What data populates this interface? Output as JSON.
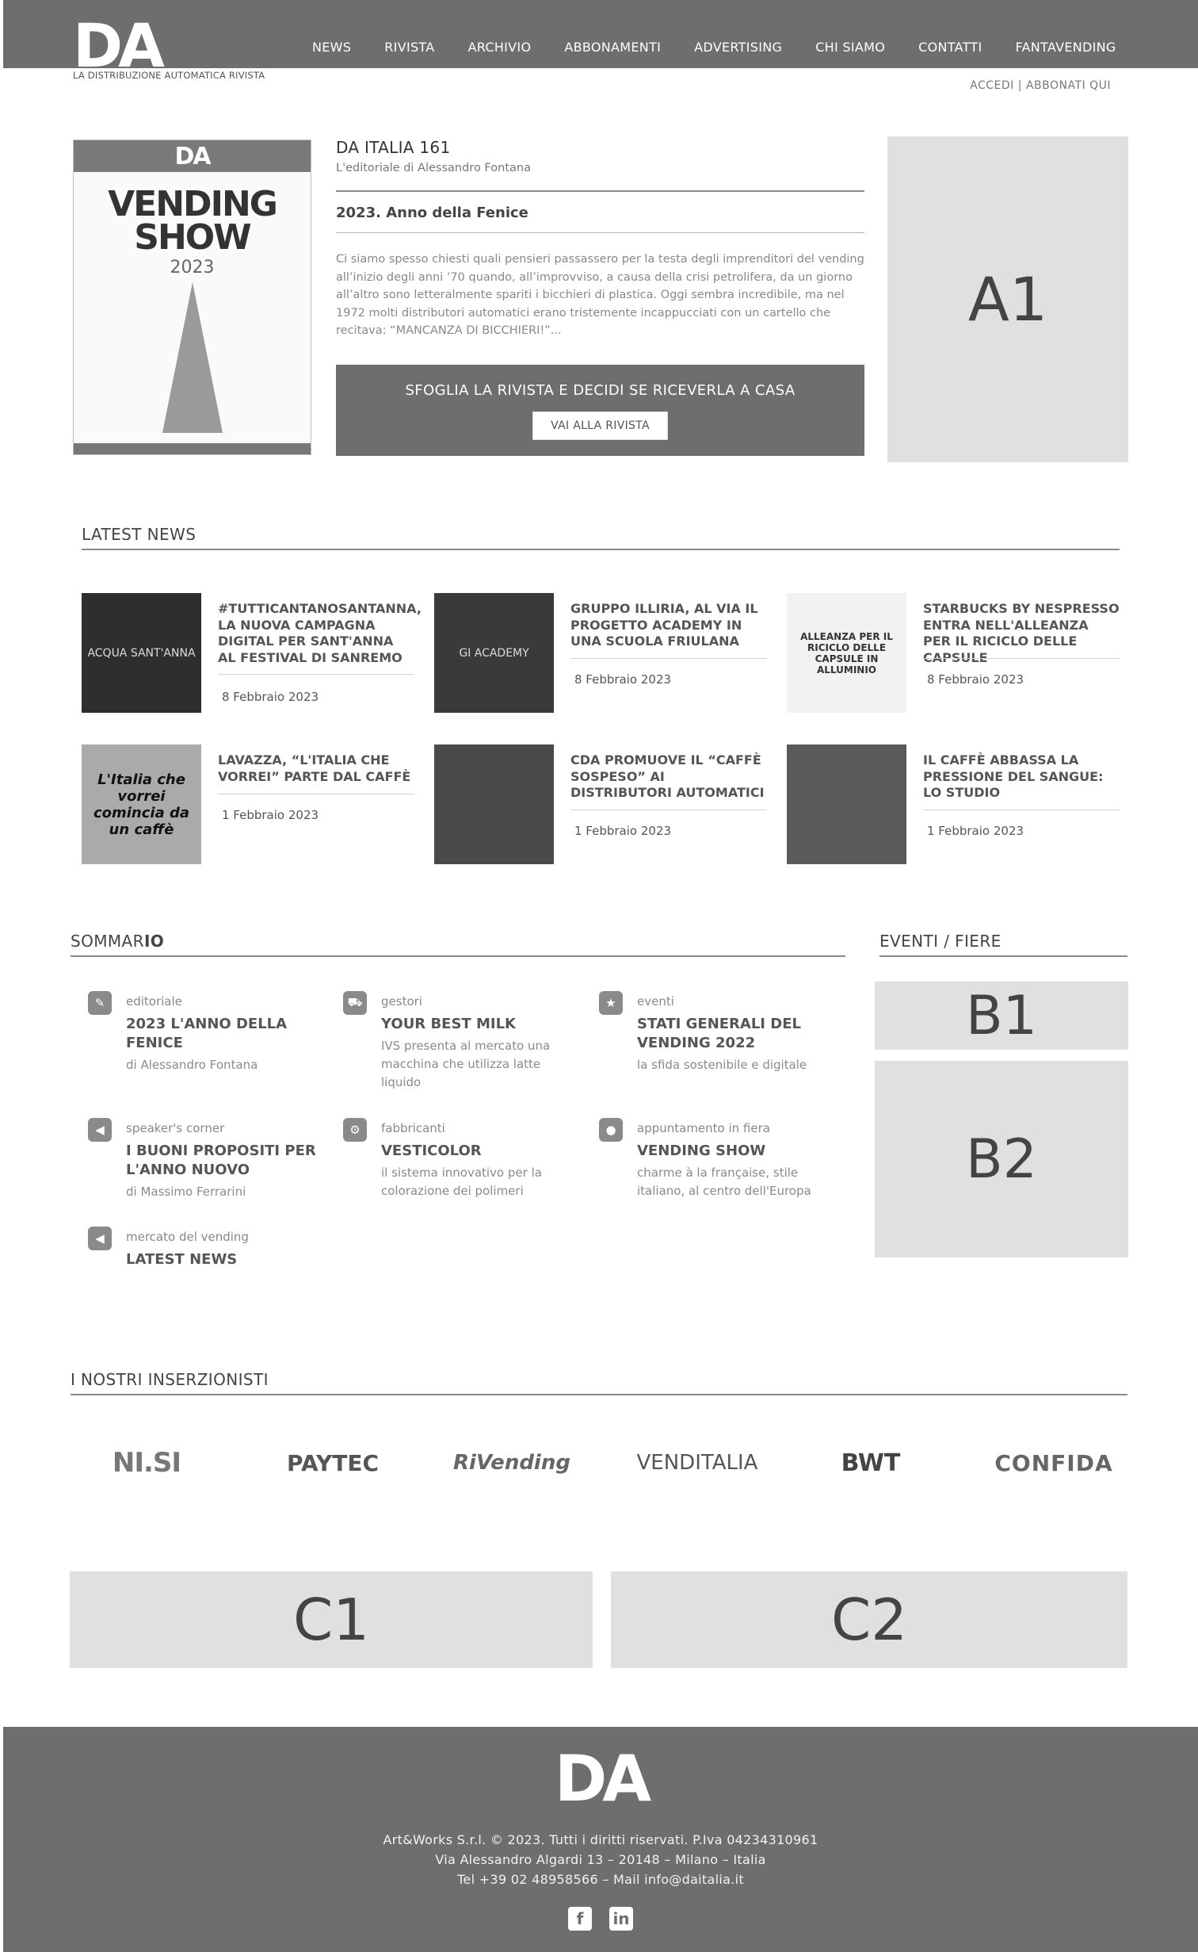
{
  "brand": {
    "logo_text": "DA",
    "tagline": "LA DISTRIBUZIONE AUTOMATICA RIVISTA"
  },
  "nav": {
    "items": [
      "NEWS",
      "RIVISTA",
      "ARCHIVIO",
      "ABBONAMENTI",
      "ADVERTISING",
      "CHI SIAMO",
      "CONTATTI",
      "FANTAVENDING"
    ]
  },
  "account": {
    "login": "ACCEDI",
    "separator": "|",
    "subscribe": "ABBONATI QUI"
  },
  "hero": {
    "cover": {
      "top": "DA",
      "title_line1": "VENDING",
      "title_line2": "SHOW",
      "year": "2023"
    },
    "label": "DA ITALIA 161",
    "author": "L'editoriale di Alessandro Fontana",
    "headline": "2023. Anno della Fenice",
    "body": "Ci siamo spesso chiesti quali pensieri passassero per la testa degli imprenditori del vending all’inizio degli anni ’70 quando, all’improvviso, a causa della crisi petrolifera, da un giorno all’altro sono letteralmente spariti i bicchieri di plastica. Oggi sembra incredibile, ma nel 1972 molti distributori automatici erano tristemente incappucciati con un cartello che recitava: “MANCANZA DI BICCHIERI!”...",
    "cta_text": "SFOGLIA LA RIVISTA E DECIDI SE RICEVERLA A CASA",
    "cta_button": "VAI ALLA RIVISTA"
  },
  "ads": {
    "a1": "A1",
    "b1": "B1",
    "b2": "B2",
    "c1": "C1",
    "c2": "C2"
  },
  "latest_news": {
    "title": "LATEST NEWS",
    "items": [
      {
        "title": "#TUTTICANTANOSANTANNA, LA NUOVA CAMPAGNA DIGITAL PER SANT'ANNA AL FESTIVAL DI SANREMO",
        "date": "8 Febbraio 2023",
        "thumb": "ACQUA SANT'ANNA"
      },
      {
        "title": "GRUPPO ILLIRIA, AL VIA IL PROGETTO ACADEMY IN UNA SCUOLA FRIULANA",
        "date": "8 Febbraio 2023",
        "thumb": "GI ACADEMY"
      },
      {
        "title": "STARBUCKS BY NESPRESSO ENTRA NELL'ALLEANZA PER IL RICICLO DELLE CAPSULE",
        "date": "8 Febbraio 2023",
        "thumb": "ALLEANZA PER IL RICICLO DELLE CAPSULE IN ALLUMINIO"
      },
      {
        "title": "LAVAZZA, “L'ITALIA CHE VORREI” PARTE DAL CAFFÈ",
        "date": "1 Febbraio 2023",
        "thumb": "L'Italia che vorrei comincia da un caffè"
      },
      {
        "title": "CDA PROMUOVE IL “CAFFÈ SOSPESO” AI DISTRIBUTORI AUTOMATICI",
        "date": "1 Febbraio 2023",
        "thumb": ""
      },
      {
        "title": "IL CAFFÈ ABBASSA LA PRESSIONE DEL SANGUE: LO STUDIO",
        "date": "1 Febbraio 2023",
        "thumb": ""
      }
    ]
  },
  "sommario": {
    "title_a": "SOMMAR",
    "title_b": "IO",
    "items": [
      {
        "category": "editoriale",
        "title": "2023 L'ANNO DELLA FENICE",
        "desc": "di Alessandro Fontana"
      },
      {
        "category": "gestori",
        "title": "YOUR BEST MILK",
        "desc": "IVS presenta al mercato una macchina che utilizza latte liquido"
      },
      {
        "category": "eventi",
        "title": "STATI GENERALI DEL VENDING 2022",
        "desc": "la sfida sostenibile e digitale"
      },
      {
        "category": "speaker's corner",
        "title": "I BUONI PROPOSITI PER L'ANNO NUOVO",
        "desc": "di Massimo Ferrarini"
      },
      {
        "category": "fabbricanti",
        "title": "VESTICOLOR",
        "desc": "il sistema innovativo per la colorazione dei polimeri"
      },
      {
        "category": "appuntamento in fiera",
        "title": "VENDING SHOW",
        "desc": "charme à la française, stile italiano, al centro dell'Europa"
      },
      {
        "category": "mercato del vending",
        "title": "LATEST NEWS",
        "desc": ""
      }
    ]
  },
  "eventi": {
    "title": "EVENTI / FIERE"
  },
  "inserzionisti": {
    "title": "I NOSTRI INSERZIONISTI",
    "logos": [
      "NI.SI",
      "PAYTEC",
      "RiVending",
      "VENDITALIA",
      "BWT",
      "CONFIDA"
    ]
  },
  "footer": {
    "logo_text": "DA",
    "line1": "Art&Works S.r.l. © 2023. Tutti i diritti riservati. P.Iva 04234310961",
    "line2": "Via Alessandro Algardi 13 – 20148 – Milano – Italia",
    "line3": "Tel +39 02 48958566 – Mail info@daitalia.it",
    "social": [
      "facebook",
      "linkedin"
    ]
  },
  "colors": {
    "header_bg": "#6e6e6e",
    "ad_bg": "#e0e0e0",
    "footer_bg": "#6e6e6e"
  }
}
